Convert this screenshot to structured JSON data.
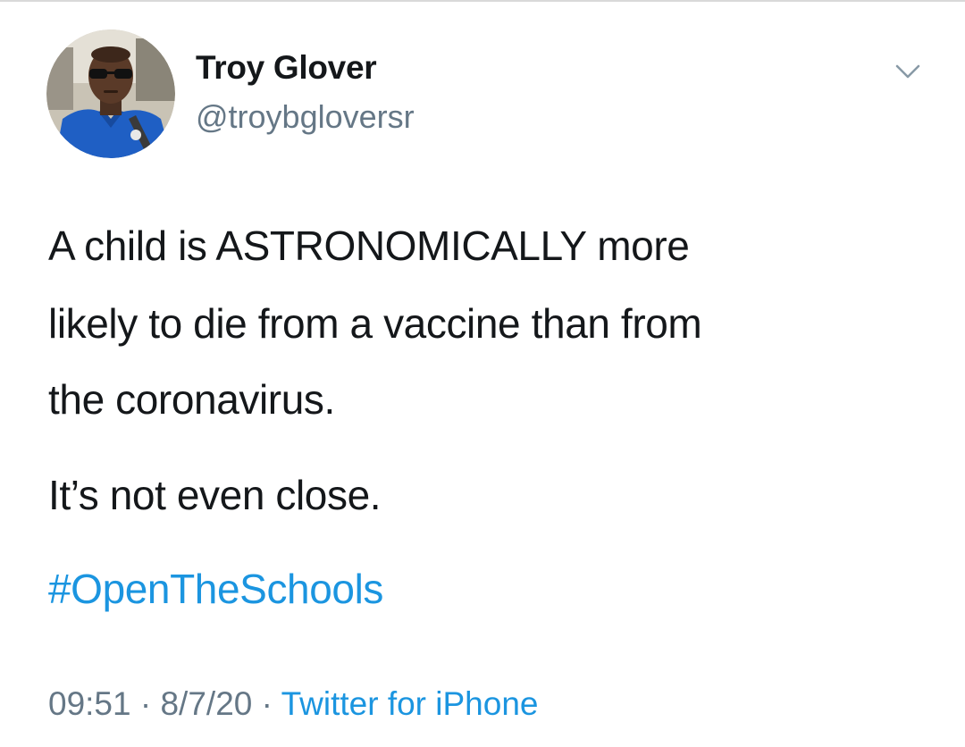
{
  "tweet": {
    "author": {
      "name": "Troy Glover",
      "handle": "@troybgloversr"
    },
    "text_lines": [
      "A child is ASTRONOMICALLY more",
      "likely to die from a vaccine than from",
      "the coronavirus.",
      "It’s not even close."
    ],
    "hashtag": "#OpenTheSchools",
    "meta": {
      "time": "09:51",
      "separator": " · ",
      "date": "8/7/20",
      "source": "Twitter for iPhone"
    }
  },
  "icons": {
    "menu": "chevron-down-icon",
    "avatar": "profile-photo"
  },
  "colors": {
    "text": "#14171a",
    "secondary": "#657786",
    "link": "#1b95e0",
    "background": "#ffffff"
  }
}
